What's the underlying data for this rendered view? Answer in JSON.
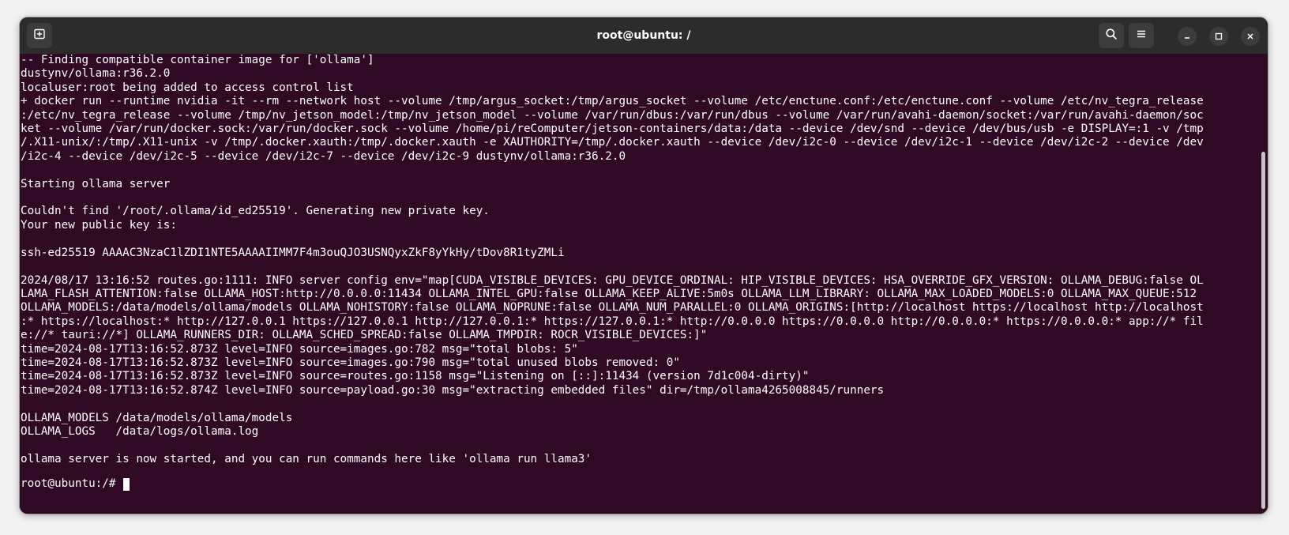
{
  "window": {
    "title": "root@ubuntu: /"
  },
  "titlebar": {
    "icons": {
      "new_tab": "new-tab-icon",
      "search": "search-icon",
      "menu": "hamburger-menu-icon",
      "minimize": "minimize-icon",
      "maximize": "maximize-icon",
      "close": "close-icon"
    }
  },
  "terminal": {
    "colors": {
      "background": "#300a24",
      "foreground": "#ffffff",
      "titlebar": "#2c2c2c"
    },
    "output": "-- Finding compatible container image for ['ollama']\ndustynv/ollama:r36.2.0\nlocaluser:root being added to access control list\n+ docker run --runtime nvidia -it --rm --network host --volume /tmp/argus_socket:/tmp/argus_socket --volume /etc/enctune.conf:/etc/enctune.conf --volume /etc/nv_tegra_release\n:/etc/nv_tegra_release --volume /tmp/nv_jetson_model:/tmp/nv_jetson_model --volume /var/run/dbus:/var/run/dbus --volume /var/run/avahi-daemon/socket:/var/run/avahi-daemon/soc\nket --volume /var/run/docker.sock:/var/run/docker.sock --volume /home/pi/reComputer/jetson-containers/data:/data --device /dev/snd --device /dev/bus/usb -e DISPLAY=:1 -v /tmp\n/.X11-unix/:/tmp/.X11-unix -v /tmp/.docker.xauth:/tmp/.docker.xauth -e XAUTHORITY=/tmp/.docker.xauth --device /dev/i2c-0 --device /dev/i2c-1 --device /dev/i2c-2 --device /dev\n/i2c-4 --device /dev/i2c-5 --device /dev/i2c-7 --device /dev/i2c-9 dustynv/ollama:r36.2.0\n\nStarting ollama server\n\nCouldn't find '/root/.ollama/id_ed25519'. Generating new private key.\nYour new public key is:\n\nssh-ed25519 AAAAC3NzaC1lZDI1NTE5AAAAIIMM7F4m3ouQJO3USNQyxZkF8yYkHy/tDov8R1tyZMLi\n\n2024/08/17 13:16:52 routes.go:1111: INFO server config env=\"map[CUDA_VISIBLE_DEVICES: GPU_DEVICE_ORDINAL: HIP_VISIBLE_DEVICES: HSA_OVERRIDE_GFX_VERSION: OLLAMA_DEBUG:false OL\nLAMA_FLASH_ATTENTION:false OLLAMA_HOST:http://0.0.0.0:11434 OLLAMA_INTEL_GPU:false OLLAMA_KEEP_ALIVE:5m0s OLLAMA_LLM_LIBRARY: OLLAMA_MAX_LOADED_MODELS:0 OLLAMA_MAX_QUEUE:512\nOLLAMA_MODELS:/data/models/ollama/models OLLAMA_NOHISTORY:false OLLAMA_NOPRUNE:false OLLAMA_NUM_PARALLEL:0 OLLAMA_ORIGINS:[http://localhost https://localhost http://localhost\n:* https://localhost:* http://127.0.0.1 https://127.0.0.1 http://127.0.0.1:* https://127.0.0.1:* http://0.0.0.0 https://0.0.0.0 http://0.0.0.0:* https://0.0.0.0:* app://* fil\ne://* tauri://*] OLLAMA_RUNNERS_DIR: OLLAMA_SCHED_SPREAD:false OLLAMA_TMPDIR: ROCR_VISIBLE_DEVICES:]\"\ntime=2024-08-17T13:16:52.873Z level=INFO source=images.go:782 msg=\"total blobs: 5\"\ntime=2024-08-17T13:16:52.873Z level=INFO source=images.go:790 msg=\"total unused blobs removed: 0\"\ntime=2024-08-17T13:16:52.873Z level=INFO source=routes.go:1158 msg=\"Listening on [::]:11434 (version 7d1c004-dirty)\"\ntime=2024-08-17T13:16:52.874Z level=INFO source=payload.go:30 msg=\"extracting embedded files\" dir=/tmp/ollama4265008845/runners\n\nOLLAMA_MODELS /data/models/ollama/models\nOLLAMA_LOGS   /data/logs/ollama.log\n\nollama server is now started, and you can run commands here like 'ollama run llama3'",
    "prompt": "root@ubuntu:/# "
  }
}
